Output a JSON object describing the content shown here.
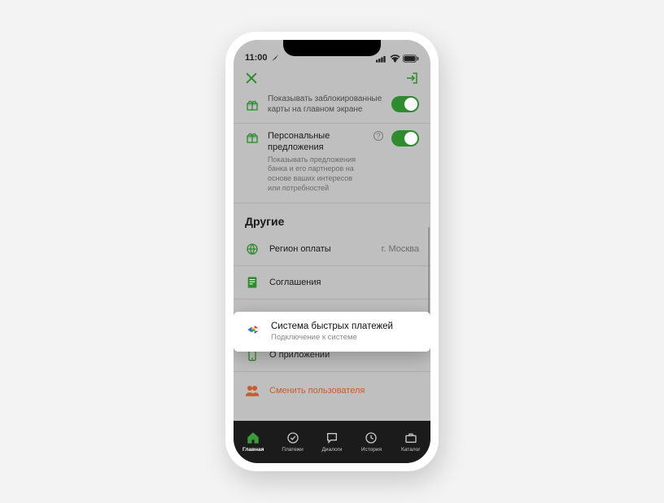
{
  "status": {
    "time": "11:00"
  },
  "settings": {
    "blocked_cards": {
      "title": "Показывать заблокированные",
      "subtitle": "карты на главном экране"
    },
    "personal_offers": {
      "title": "Персональные предложения",
      "desc": "Показывать предложения банка и его партнеров на основе ваших интересов или потребностей"
    }
  },
  "section_other": {
    "heading": "Другие",
    "region": {
      "label": "Регион оплаты",
      "value": "г. Москва"
    },
    "agreements": {
      "label": "Соглашения"
    },
    "sbp": {
      "label": "Система быстрых платежей",
      "sublabel": "Подключение к системе"
    },
    "about": {
      "label": "О приложении"
    },
    "switch_user": {
      "label": "Сменить пользователя"
    }
  },
  "tabs": {
    "home": "Главная",
    "payments": "Платежи",
    "dialogs": "Диалоги",
    "history": "История",
    "catalog": "Каталог"
  }
}
